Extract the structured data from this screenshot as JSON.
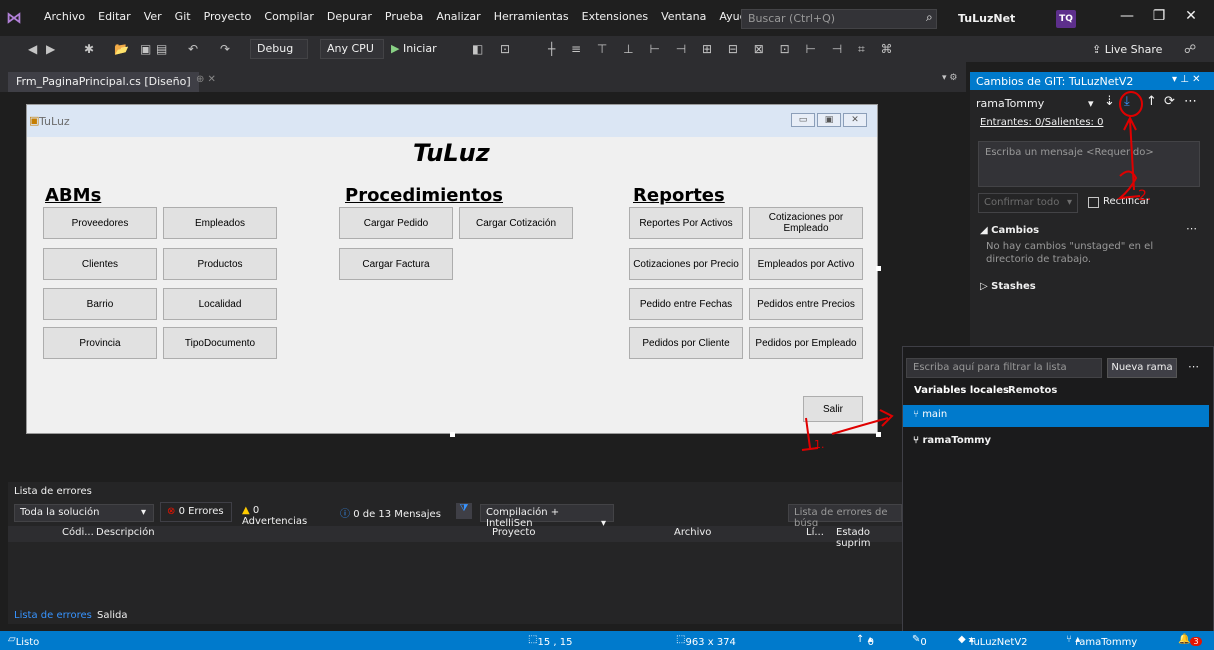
{
  "menubar": {
    "items": [
      "Archivo",
      "Editar",
      "Ver",
      "Git",
      "Proyecto",
      "Compilar",
      "Depurar",
      "Prueba",
      "Analizar",
      "Herramientas",
      "Extensiones",
      "Ventana",
      "Ayuda"
    ],
    "search_placeholder": "Buscar (Ctrl+Q)",
    "solution_name": "TuLuzNet",
    "avatar_initials": "TQ"
  },
  "toolbar": {
    "config": "Debug",
    "platform": "Any CPU",
    "run_label": "Iniciar",
    "live_share": "Live Share"
  },
  "document_tab": {
    "label": "Frm_PaginaPrincipal.cs [Diseño]"
  },
  "form": {
    "window_title": "TuLuz",
    "app_title": "TuLuz",
    "sections": {
      "abms": "ABMs",
      "procedimientos": "Procedimientos",
      "reportes": "Reportes"
    },
    "abm_buttons": [
      "Proveedores",
      "Empleados",
      "Clientes",
      "Productos",
      "Barrio",
      "Localidad",
      "Provincia",
      "TipoDocumento"
    ],
    "proc_buttons": [
      "Cargar Pedido",
      "Cargar Cotización",
      "Cargar Factura"
    ],
    "report_buttons": [
      "Reportes Por Activos",
      "Cotizaciones por Empleado",
      "Cotizaciones por Precio",
      "Empleados por Activo",
      "Pedido entre Fechas",
      "Pedidos entre Precios",
      "Pedidos por Cliente",
      "Pedidos por Empleado"
    ],
    "exit_button": "Salir"
  },
  "git_panel": {
    "title": "Cambios de GIT: TuLuzNetV2",
    "branch": "ramaTommy",
    "incoming_outgoing": "Entrantes: 0/Salientes: 0",
    "commit_placeholder": "Escriba un mensaje <Requerido>",
    "confirm_all": "Confirmar todo",
    "amend": "Rectificar",
    "changes_header": "Cambios",
    "changes_empty": "No hay cambios \"unstaged\" en el directorio de trabajo.",
    "stashes_header": "Stashes"
  },
  "branch_popup": {
    "filter_placeholder": "Escriba aquí para filtrar la lista",
    "new_branch": "Nueva rama",
    "tab_local": "Variables locales",
    "tab_remote": "Remotos",
    "branches": [
      "main",
      "ramaTommy"
    ]
  },
  "error_list": {
    "title": "Lista de errores",
    "scope": "Toda la solución",
    "errors": "0 Errores",
    "warnings": "0 Advertencias",
    "messages": "0 de 13 Mensajes",
    "build_filter": "Compilación + IntelliSen",
    "search_placeholder": "Lista de errores de búsq",
    "columns": [
      "Códi...",
      "Descripción",
      "Proyecto",
      "Archivo",
      "Lí...",
      "Estado suprim"
    ],
    "bottom_tabs": [
      "Lista de errores",
      "Salida"
    ]
  },
  "statusbar": {
    "status": "Listo",
    "position": "15 , 15",
    "size": "963 x 374",
    "up_count": "0",
    "pencil_count": "0",
    "repo": "TuLuzNetV2",
    "branch": "ramaTommy",
    "notifications": "3"
  },
  "annotations": {
    "step1": "1.",
    "step2": "2."
  },
  "colors": {
    "accent": "#007acc",
    "menubar_bg": "#1f1f1f",
    "panel_bg": "#252526",
    "form_bg": "#f0f0f0"
  }
}
